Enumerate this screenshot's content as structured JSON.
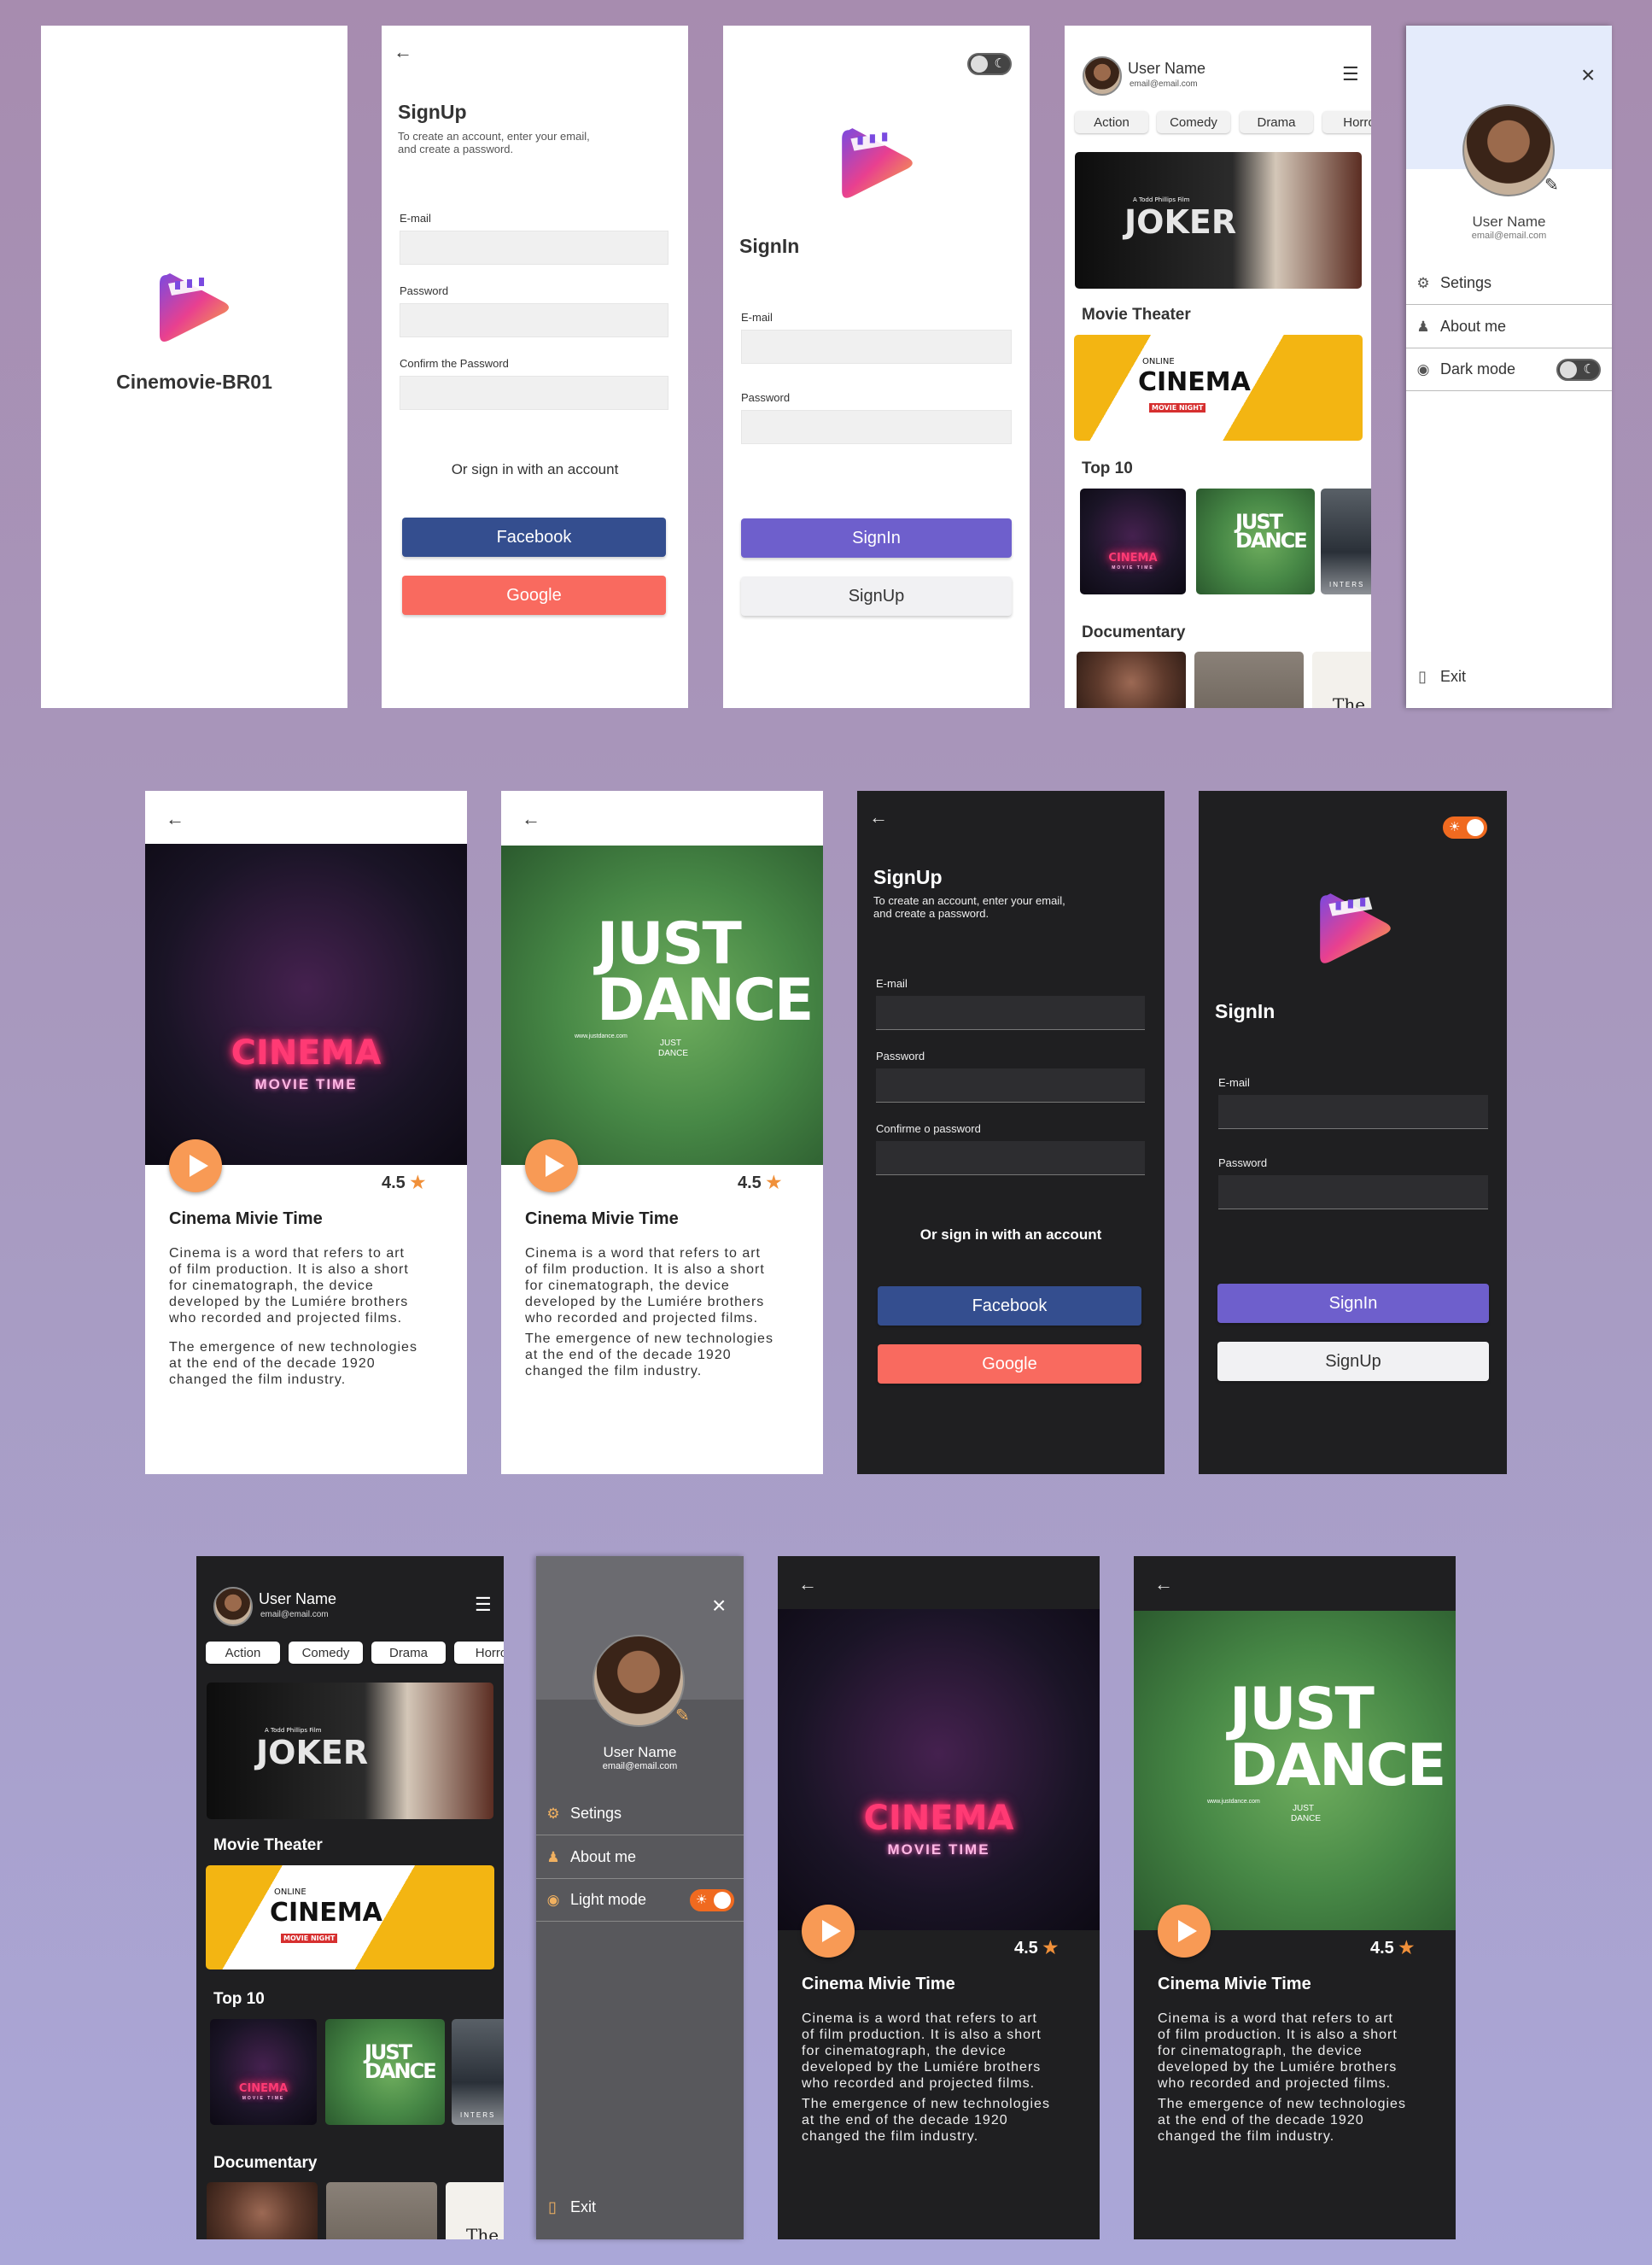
{
  "app": {
    "name": "Cinemovie-BR01"
  },
  "icons": {
    "back": "←",
    "close": "×",
    "menu": "☰",
    "edit": "✎",
    "sun": "☀",
    "moon": "☾",
    "star": "★",
    "gear": "⚙",
    "person": "♟",
    "eye": "◉",
    "exit": "▯"
  },
  "signup": {
    "title": "SignUp",
    "subtitle_line1": "To create an account, enter your email,",
    "subtitle_line2": "and create a password.",
    "email_label": "E-mail",
    "password_label": "Password",
    "confirm_label": "Confirm the Password",
    "confirm_label_dark": "Confirme o password",
    "or_text": "Or sign in with an account",
    "facebook": "Facebook",
    "google": "Google"
  },
  "signin": {
    "title": "SignIn",
    "email_label": "E-mail",
    "password_label": "Password",
    "signin_button": "SignIn",
    "signup_button": "SignUp"
  },
  "home": {
    "user_name": "User Name",
    "user_email": "email@email.com",
    "categories": [
      "Action",
      "Comedy",
      "Drama",
      "Horro"
    ],
    "sections": {
      "theater": "Movie Theater",
      "top10": "Top 10",
      "documentary": "Documentary"
    },
    "joker": {
      "small": "A Todd Phillips Film",
      "title": "JOKER"
    },
    "theater": {
      "online": "ONLINE",
      "cinema": "CINEMA",
      "night": "MOVIE NIGHT"
    },
    "inter": "INTERS",
    "doc3": "The N"
  },
  "drawer": {
    "user_name": "User Name",
    "user_email": "email@email.com",
    "settings": "Setings",
    "about": "About me",
    "dark_mode": "Dark mode",
    "light_mode": "Light mode",
    "exit": "Exit"
  },
  "detail": {
    "title": "Cinema Mivie Time",
    "rating": "4.5",
    "desc1": [
      "Cinema is a word that refers to art",
      "of film production. It is also a short",
      "for cinematograph, the device",
      "developed by the Lumiére brothers",
      "who recorded and projected films."
    ],
    "desc2": [
      "The emergence of new technologies",
      "at the end of the decade 1920",
      "changed the film industry."
    ],
    "cinema_poster": {
      "line1": "CINEMA",
      "line2": "MOVIE TIME"
    },
    "dance_poster": {
      "line1": "JUST",
      "line2": "DANCE",
      "url": "www.justdance.com",
      "small1": "JUST",
      "small2": "DANCE"
    }
  },
  "colors": {
    "facebook": "#344e8f",
    "google": "#f96a5f",
    "signin": "#6e5fcc",
    "accent": "#f89a55",
    "dark_bg": "#1f1f21"
  }
}
